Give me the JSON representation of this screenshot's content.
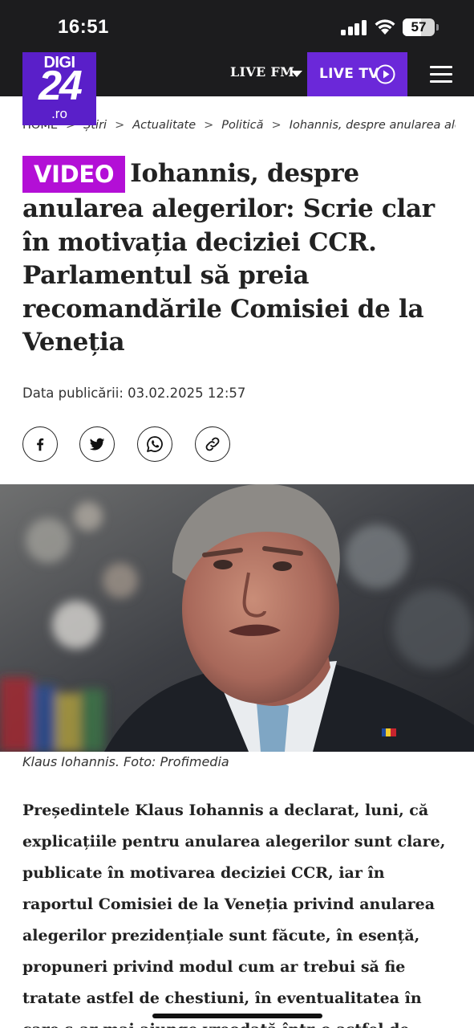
{
  "status_bar": {
    "time": "16:51",
    "battery": "57",
    "battery_level_percent": 57,
    "icons": [
      "signal-icon",
      "wifi-icon",
      "battery-icon"
    ]
  },
  "header": {
    "logo": {
      "line1": "DIGI",
      "line2": "24",
      "suffix": ".ro"
    },
    "live_fm": "LIVE FM",
    "live_tv": "LIVE TV",
    "icons": [
      "caret-down-icon",
      "play-icon",
      "menu-icon"
    ],
    "colors": {
      "bar": "#1c1c1e",
      "live_tv_bg": "#6b28d9",
      "logo_bg": "#5a1fc9"
    }
  },
  "breadcrumb": [
    "HOME",
    "Știri",
    "Actualitate",
    "Politică",
    "Iohannis, despre anularea aleg…"
  ],
  "article": {
    "badge": "VIDEO",
    "badge_color": "#b30fd6",
    "title": "Iohannis, despre anularea alegerilor: Scrie clar în motivația deciziei CCR. Parlamentul să preia recomandările Comisiei de la Veneția",
    "published": "Data publicării: 03.02.2025 12:57",
    "share_icons": [
      "facebook-icon",
      "twitter-icon",
      "whatsapp-icon",
      "link-icon"
    ],
    "photo_caption": "Klaus Iohannis. Foto: Profimedia",
    "lead": "Președintele Klaus Iohannis a declarat, luni, că explicațiile pentru anularea alegerilor sunt clare, publicate în motivarea deciziei CCR, iar în raportul Comisiei de la Veneția privind anularea alegerilor prezidențiale sunt făcute, în esență, propuneri privind modul cum ar trebui să fie tratate astfel de chestiuni, în eventualitatea în care s-ar mai ajunge vreodată într-o astfel de"
  }
}
